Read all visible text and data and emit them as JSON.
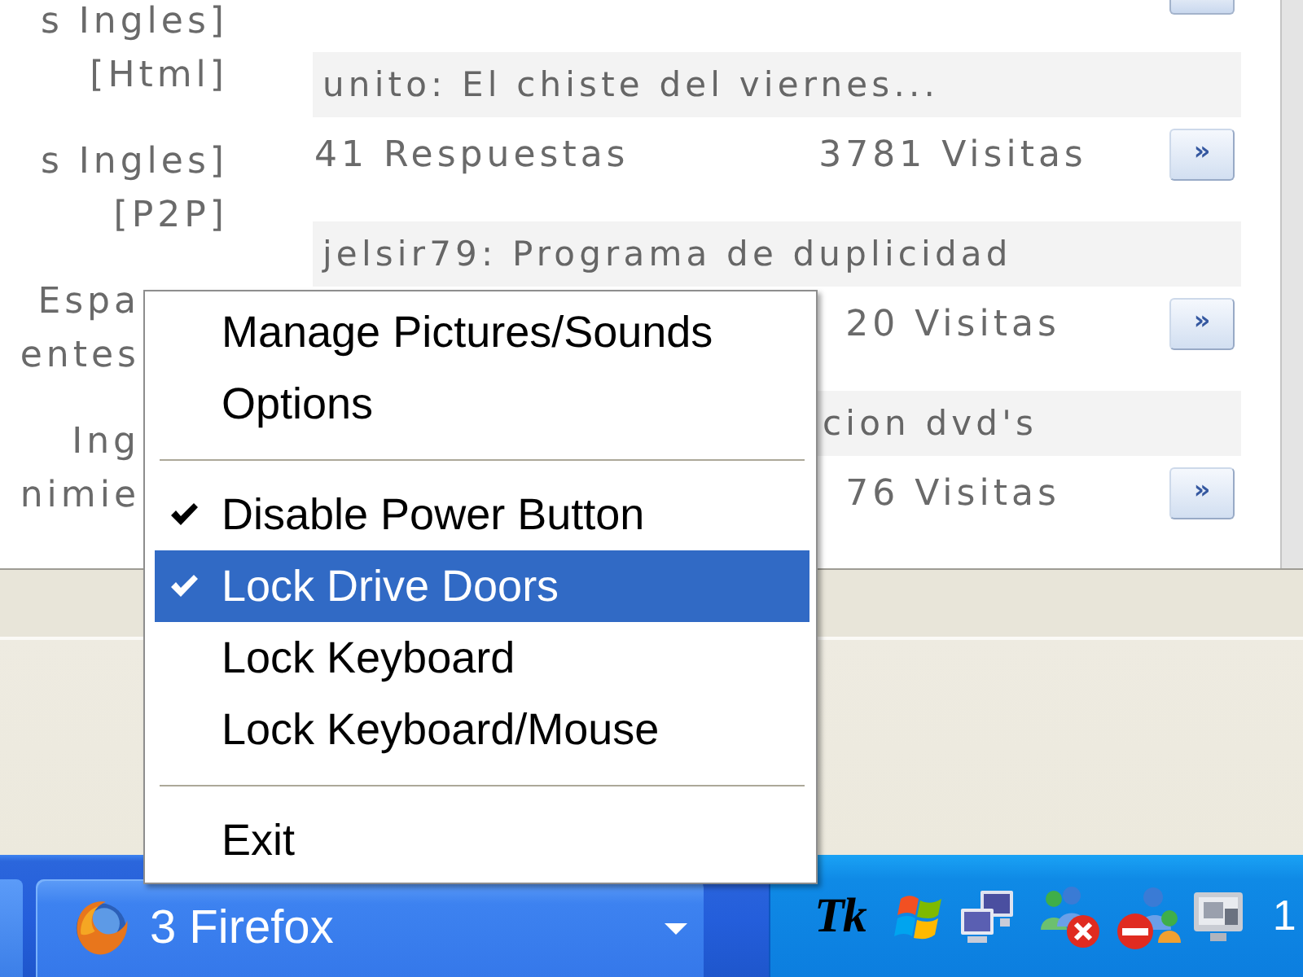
{
  "page": {
    "left_column": [
      {
        "lines": [
          "s Ingles]",
          "[Html]"
        ]
      },
      {
        "lines": [
          "s Ingles]",
          "[P2P]"
        ]
      },
      {
        "lines": [
          "Espa",
          "entes"
        ]
      },
      {
        "lines": [
          "Ing",
          "nimie"
        ]
      }
    ],
    "topics": [
      {
        "title": "unito: El chiste del viernes...",
        "replies": "41 Respuestas",
        "views": "3781 Visitas",
        "button": "»"
      },
      {
        "title": "jelsir79: Programa de duplicidad",
        "views": "20 Visitas",
        "button": "»"
      },
      {
        "title": "cion dvd's",
        "views": "76 Visitas",
        "button": "»"
      }
    ]
  },
  "context_menu": {
    "items": [
      {
        "kind": "item",
        "label": "Manage Pictures/Sounds",
        "checked": false,
        "selected": false
      },
      {
        "kind": "item",
        "label": "Options",
        "checked": false,
        "selected": false
      },
      {
        "kind": "separator"
      },
      {
        "kind": "item",
        "label": "Disable Power Button",
        "checked": true,
        "selected": false
      },
      {
        "kind": "item",
        "label": "Lock Drive Doors",
        "checked": true,
        "selected": true
      },
      {
        "kind": "item",
        "label": "Lock Keyboard",
        "checked": false,
        "selected": false
      },
      {
        "kind": "item",
        "label": "Lock Keyboard/Mouse",
        "checked": false,
        "selected": false
      },
      {
        "kind": "separator"
      },
      {
        "kind": "item",
        "label": "Exit",
        "checked": false,
        "selected": false
      }
    ]
  },
  "taskbar": {
    "buttons": [
      {
        "label": "3 Firefox"
      }
    ],
    "tray": {
      "app_text": "Tk",
      "clock": "1"
    }
  }
}
